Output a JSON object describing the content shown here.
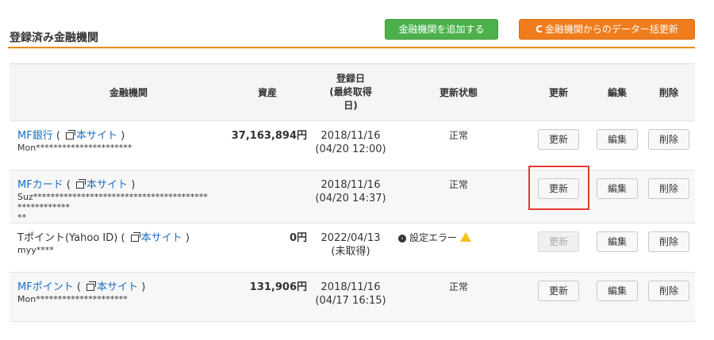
{
  "header": {
    "title": "登録済み金融機関",
    "add_button": "金融機関を追加する",
    "bulk_refresh_button": "金融機関からのデーター括更新",
    "bulk_refresh_icon": "C"
  },
  "table": {
    "columns": {
      "institution": "金融機関",
      "assets": "資産",
      "registered_line1": "登録日",
      "registered_line2": "(最終取得",
      "registered_line3": "日)",
      "status": "更新状態",
      "update": "更新",
      "edit": "編集",
      "delete": "削除"
    },
    "site_link": "本サイト",
    "open_paren": " ( ",
    "close_paren": " )",
    "rows": [
      {
        "name": "MF銀行",
        "account": "Mon**********************",
        "assets": "37,163,894円",
        "date": "2018/11/16",
        "last": "(04/20 12:00)",
        "status": "正常",
        "update_label": "更新",
        "edit_label": "編集",
        "delete_label": "削除"
      },
      {
        "name": "MFカード",
        "account": "Suz****************************************************",
        "account2": "**",
        "assets": "",
        "date": "2018/11/16",
        "last": "(04/20 14:37)",
        "status": "正常",
        "update_label": "更新",
        "edit_label": "編集",
        "delete_label": "削除"
      },
      {
        "name": "Tポイント(Yahoo ID)",
        "account": "myy****",
        "assets": "0円",
        "date": "2022/04/13",
        "last": "(未取得)",
        "status": "設定エラー",
        "update_label": "更新",
        "edit_label": "編集",
        "delete_label": "削除"
      },
      {
        "name": "MFポイント",
        "account": "Mon*********************",
        "assets": "131,906円",
        "date": "2018/11/16",
        "last": "(04/17 16:15)",
        "status": "正常",
        "update_label": "更新",
        "edit_label": "編集",
        "delete_label": "削除"
      }
    ]
  },
  "colors": {
    "accent_orange": "#ef7d1d",
    "add_green": "#4cb14c",
    "link_blue": "#1a6fc4",
    "highlight_red": "#e53935"
  }
}
